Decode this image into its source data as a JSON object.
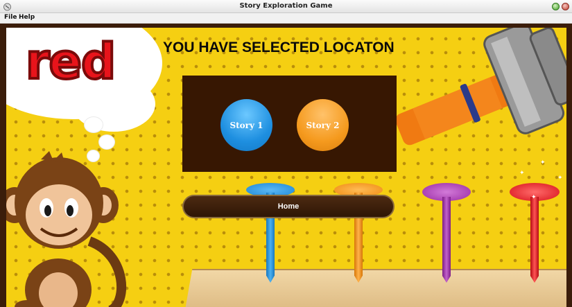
{
  "window": {
    "title": "Story Exploration Game"
  },
  "menu": {
    "file": "File",
    "help": "Help"
  },
  "scene": {
    "color_word": "red",
    "headline": "YOU HAVE SELECTED LOCATON",
    "story_buttons": [
      "Story 1",
      "Story 2"
    ],
    "home_label": "Home"
  },
  "colors": {
    "background": "#f5cf12",
    "panel": "#371702",
    "story1": "#1e8fe0",
    "story2": "#f59a1e",
    "color_word": "#e8141b"
  }
}
